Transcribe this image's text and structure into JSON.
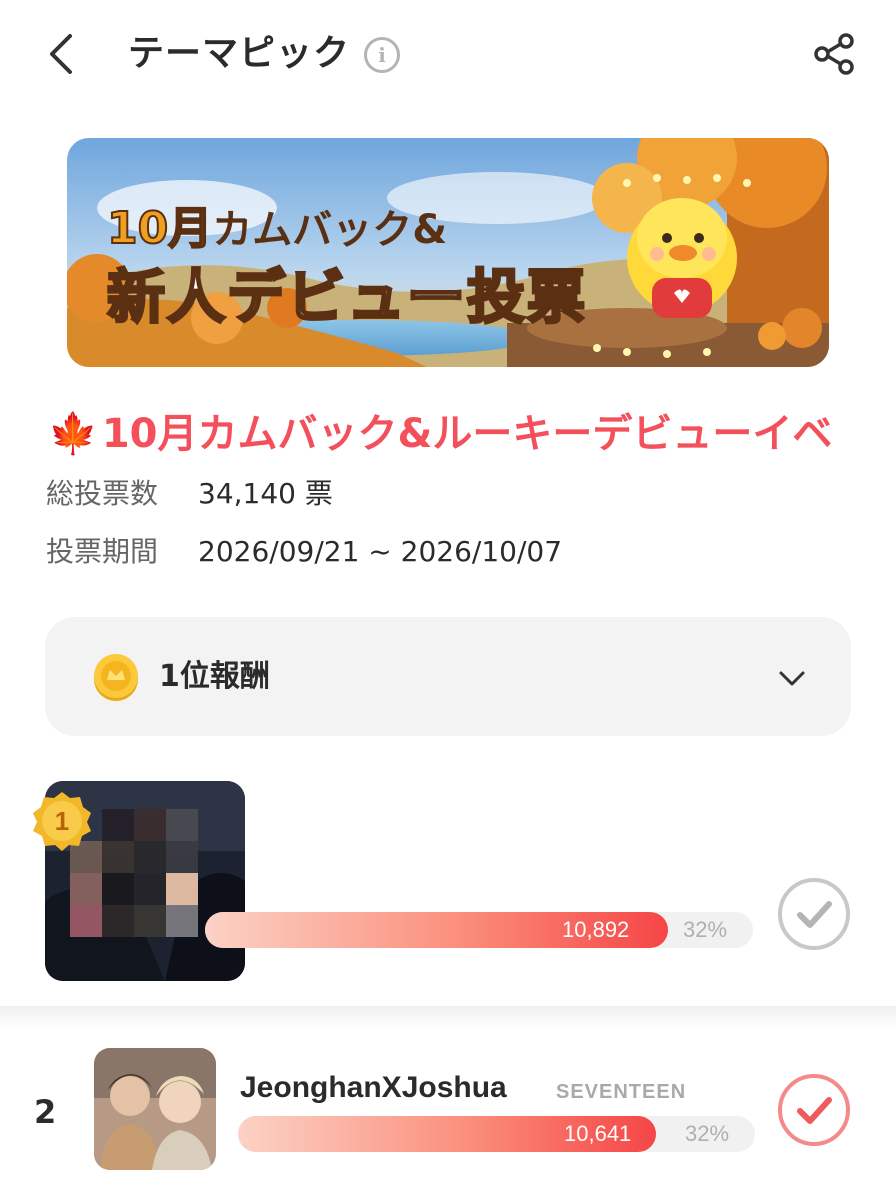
{
  "header": {
    "title": "テーマピック",
    "info_icon": "info-icon",
    "back_icon": "chevron-left-icon",
    "share_icon": "share-icon"
  },
  "banner": {
    "month": "10月",
    "line1_rest": "カムバック&",
    "line2": "新人デビュー投票"
  },
  "event": {
    "title": "10月カムバック&ルーキーデビューイベ",
    "title_icon": "maple-leaf-icon",
    "total_label": "総投票数",
    "total_value": "34,140 票",
    "period_label": "投票期間",
    "period_value": "2026/09/21 ~ 2026/10/07"
  },
  "reward": {
    "label": "1位報酬",
    "icon": "coin-icon",
    "toggle_icon": "chevron-down-icon"
  },
  "candidates": [
    {
      "rank": "1",
      "name": "",
      "group": "",
      "votes": "10,892",
      "percent": "32%",
      "share": 0.32,
      "selected": false
    },
    {
      "rank": "2",
      "name": "JeonghanXJoshua",
      "group": "SEVENTEEN",
      "votes": "10,641",
      "percent": "32%",
      "share": 0.32,
      "selected": true
    }
  ],
  "colors": {
    "accent": "#f3505c",
    "bar_end": "#f54646",
    "check_selected": "#f48a8a",
    "check_unselected": "#c8c8c8"
  }
}
